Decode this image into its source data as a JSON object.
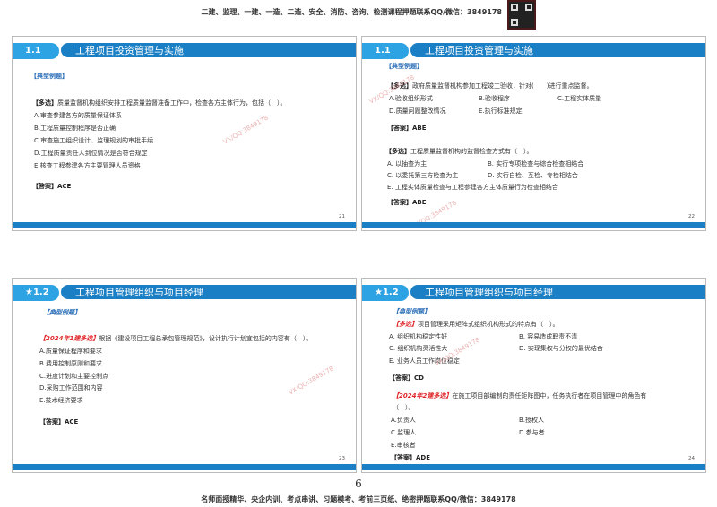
{
  "header_text": "二建、监理、一建、一造、二造、安全、消防、咨询、检测课程押题联系QQ/微信：3849178",
  "watermark": "VX/QQ:3849178",
  "page_number": "6",
  "footer_text": "名师面授精华、央企内训、考点串讲、习题模考、考前三页纸、绝密押题联系QQ/微信：3849178",
  "slides": [
    {
      "badge": "1.1",
      "title": "工程项目投资管理与实施",
      "label": "【典型例题】",
      "page": "21",
      "q1": {
        "tag": "【多选】",
        "text": "质量监督机构组织安排工程质量监督准备工作中，检查各方主体行为，包括（　）。",
        "options": [
          "A.审查参建各方的质量保证体系",
          "B.工程质量控制程序是否正确",
          "C.审查施工组织设计、监理规划的审批手续",
          "D.工程质量责任人到位情况是否符合规定",
          "E.核查工程参建各方主要管理人员资格"
        ],
        "answer": "【答案】ACE"
      }
    },
    {
      "badge": "1.1",
      "title": "工程项目投资管理与实施",
      "label": "【典型例题】",
      "page": "22",
      "q1": {
        "tag": "【多选】",
        "text": "政府质量监督机构参加工程竣工验收，针对(　　)进行重点监督。",
        "options": [
          "A.验收组织形式",
          "B.验收程序",
          "C.工程实体质量",
          "D.质量问题整改情况",
          "E.执行标准规定"
        ],
        "answer": "【答案】ABE"
      },
      "q2": {
        "tag": "【多选】",
        "text": "工程质量监督机构的监督检查方式有（　）。",
        "options": [
          "A. 以抽查为主",
          "B. 实行专项检查与综合检查相结合",
          "C. 以委托第三方检查为主",
          "D. 实行自检、互检、专检相结合",
          "E. 工程实体质量检查与工程参建各方主体质量行为检查相结合"
        ],
        "answer": "【答案】ABE"
      }
    },
    {
      "badge": "★1.2",
      "title": "工程项目管理组织与项目经理",
      "label": "【典型例题】",
      "page": "23",
      "q1": {
        "tag": "【2024年1建多选】",
        "text": "根据《建设项目工程总承包管理规范》，设计执行计划宜包括的内容有（　）。",
        "options": [
          "A.质量保证程序和要求",
          "B.费用控制原则和要求",
          "C.进度计划和主要控制点",
          "D.采购工作范围和内容",
          "E.技术经济要求"
        ],
        "answer": "【答案】ACE"
      }
    },
    {
      "badge": "★1.2",
      "title": "工程项目管理组织与项目经理",
      "label": "【典型例题】",
      "page": "24",
      "q1": {
        "tag": "【多选】",
        "text": "项目管理采用矩阵式组织机构形式的特点有（　）。",
        "options": [
          "A. 组织机构稳定性好",
          "B. 容易造成职责不清",
          "C. 组织机构灵活性大",
          "D. 实现集权与分权的最优结合",
          "E. 业务人员工作岗位稳定"
        ],
        "answer": "【答案】CD"
      },
      "q2": {
        "tag": "【2024年2建多选】",
        "text": "在施工项目部编制的责任矩阵图中，任务执行者在项目管理中的角色有",
        "text2": "（　）。",
        "options": [
          "A.负责人",
          "B.授权人",
          "C.监理人",
          "D.参与者",
          "E.审核者"
        ],
        "answer": "【答案】ADE"
      }
    }
  ]
}
